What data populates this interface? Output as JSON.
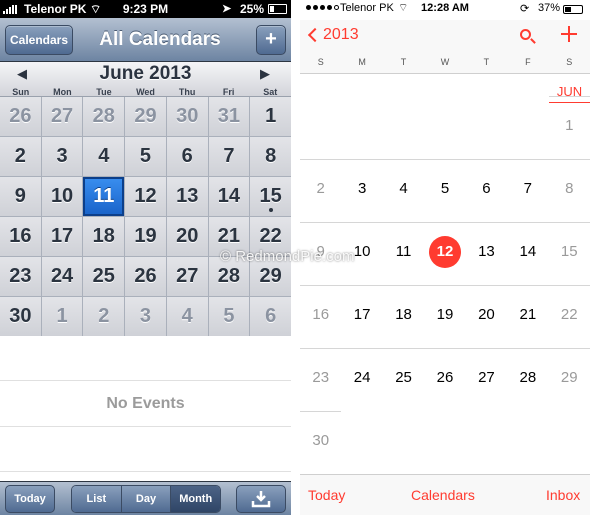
{
  "left": {
    "status": {
      "carrier": "Telenor PK",
      "time": "9:23 PM",
      "battery": "25%"
    },
    "nav": {
      "calendars_button": "Calendars",
      "title": "All Calendars",
      "add_button": "+"
    },
    "month_title": "June 2013",
    "weekdays": [
      "Sun",
      "Mon",
      "Tue",
      "Wed",
      "Thu",
      "Fri",
      "Sat"
    ],
    "weeks": [
      [
        {
          "d": "26",
          "o": true
        },
        {
          "d": "27",
          "o": true
        },
        {
          "d": "28",
          "o": true
        },
        {
          "d": "29",
          "o": true
        },
        {
          "d": "30",
          "o": true
        },
        {
          "d": "31",
          "o": true
        },
        {
          "d": "1"
        }
      ],
      [
        {
          "d": "2"
        },
        {
          "d": "3"
        },
        {
          "d": "4"
        },
        {
          "d": "5"
        },
        {
          "d": "6"
        },
        {
          "d": "7"
        },
        {
          "d": "8"
        }
      ],
      [
        {
          "d": "9"
        },
        {
          "d": "10"
        },
        {
          "d": "11",
          "sel": true
        },
        {
          "d": "12"
        },
        {
          "d": "13"
        },
        {
          "d": "14"
        },
        {
          "d": "15",
          "dot": true
        }
      ],
      [
        {
          "d": "16"
        },
        {
          "d": "17"
        },
        {
          "d": "18"
        },
        {
          "d": "19"
        },
        {
          "d": "20"
        },
        {
          "d": "21"
        },
        {
          "d": "22"
        }
      ],
      [
        {
          "d": "23"
        },
        {
          "d": "24"
        },
        {
          "d": "25"
        },
        {
          "d": "26"
        },
        {
          "d": "27"
        },
        {
          "d": "28"
        },
        {
          "d": "29"
        }
      ],
      [
        {
          "d": "30"
        },
        {
          "d": "1",
          "o": true
        },
        {
          "d": "2",
          "o": true
        },
        {
          "d": "3",
          "o": true
        },
        {
          "d": "4",
          "o": true
        },
        {
          "d": "5",
          "o": true
        },
        {
          "d": "6",
          "o": true
        }
      ]
    ],
    "no_events": "No Events",
    "toolbar": {
      "today": "Today",
      "list": "List",
      "day": "Day",
      "month": "Month"
    }
  },
  "right": {
    "status": {
      "carrier": "Telenor PK",
      "time": "12:28 AM",
      "battery": "37%"
    },
    "nav": {
      "back_label": "2013"
    },
    "weekdays": [
      "S",
      "M",
      "T",
      "W",
      "T",
      "F",
      "S"
    ],
    "month_label": "JUN",
    "weeks": [
      [
        "",
        "",
        "",
        "",
        "",
        "",
        "1"
      ],
      [
        "2",
        "3",
        "4",
        "5",
        "6",
        "7",
        "8"
      ],
      [
        "9",
        "10",
        "11",
        "12",
        "13",
        "14",
        "15"
      ],
      [
        "16",
        "17",
        "18",
        "19",
        "20",
        "21",
        "22"
      ],
      [
        "23",
        "24",
        "25",
        "26",
        "27",
        "28",
        "29"
      ],
      [
        "30",
        "",
        "",
        "",
        "",
        "",
        ""
      ]
    ],
    "today": "12",
    "tabbar": {
      "today": "Today",
      "calendars": "Calendars",
      "inbox": "Inbox"
    }
  },
  "watermark": "© RedmondPie.com",
  "colors": {
    "ios7_accent": "#ff3b30",
    "ios6_selected": "#1862c8",
    "ios6_bar": "#6d84a2"
  },
  "icons": [
    "signal-icon",
    "wifi-icon",
    "location-icon",
    "battery-icon",
    "chevron-left-icon",
    "search-icon",
    "plus-icon",
    "download-icon",
    "rotation-lock-icon"
  ]
}
